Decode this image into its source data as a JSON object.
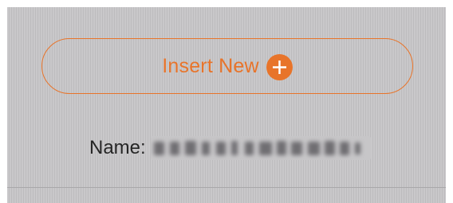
{
  "form": {
    "insert_button_label": "Insert New",
    "name_label": "Name:",
    "name_value_obscured": true
  },
  "icons": {
    "insert": "plus-circle-icon"
  },
  "colors": {
    "accent": "#e8742a",
    "panel_background": "#c4c3c5",
    "text": "#262626"
  }
}
